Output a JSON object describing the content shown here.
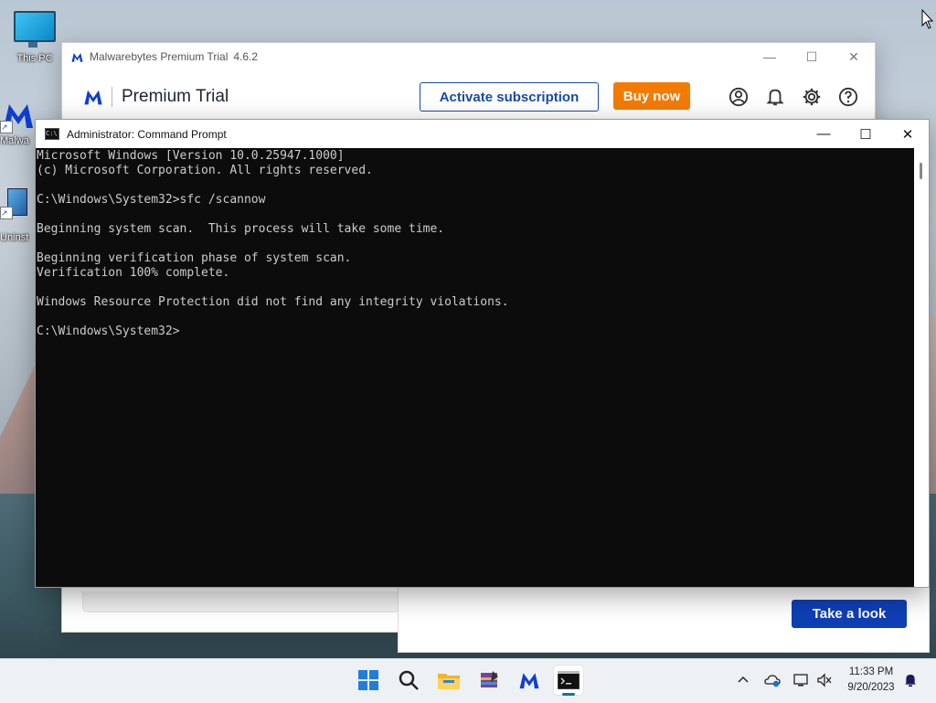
{
  "desktop": {
    "icons": [
      {
        "label": "This PC"
      },
      {
        "label": "Malwa"
      },
      {
        "label": "Uninst"
      }
    ]
  },
  "malwarebytes": {
    "window_title": "Malwarebytes Premium Trial",
    "version": "4.6.2",
    "brand": "Premium Trial",
    "activate_label": "Activate subscription",
    "buy_label": "Buy now",
    "header_icons": [
      "account-icon",
      "bell-icon",
      "gear-icon",
      "help-icon"
    ],
    "take_look_label": "Take a look",
    "colors": {
      "buy": "#f47b00",
      "activate": "#1a4aa8",
      "brand_blue": "#0d3fd1"
    }
  },
  "cmd": {
    "title": "Administrator: Command Prompt",
    "lines": [
      "Microsoft Windows [Version 10.0.25947.1000]",
      "(c) Microsoft Corporation. All rights reserved.",
      "",
      "C:\\Windows\\System32>sfc /scannow",
      "",
      "Beginning system scan.  This process will take some time.",
      "",
      "Beginning verification phase of system scan.",
      "Verification 100% complete.",
      "",
      "Windows Resource Protection did not find any integrity violations.",
      "",
      "C:\\Windows\\System32>"
    ]
  },
  "taskbar": {
    "apps": [
      "start-icon",
      "search-icon",
      "file-explorer-icon",
      "archive-app-icon",
      "malwarebytes-icon",
      "command-prompt-icon"
    ],
    "time": "11:33 PM",
    "date": "9/20/2023"
  }
}
